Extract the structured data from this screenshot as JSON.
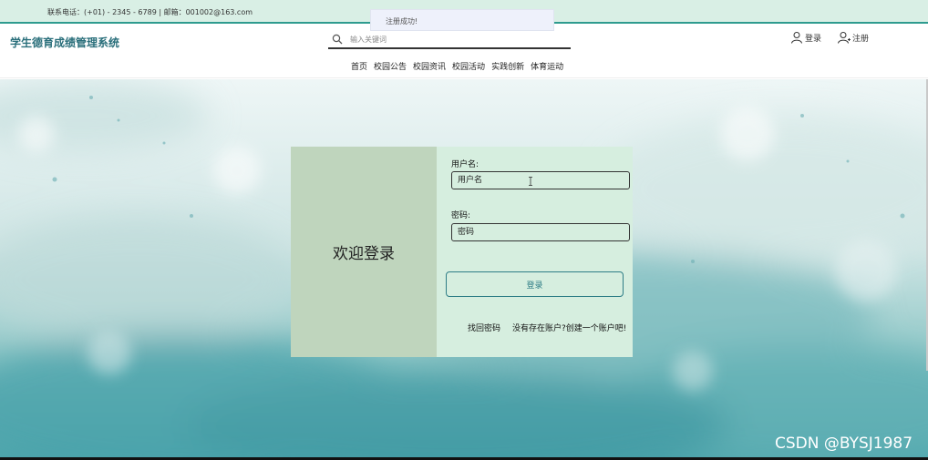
{
  "topbar": {
    "contact": "联系电话：(+01) - 2345 - 6789 | 邮箱：001002@163.com"
  },
  "toast": {
    "message": "注册成功!"
  },
  "header": {
    "site_title": "学生德育成绩管理系统",
    "search_placeholder": "输入关键词",
    "login_label": "登录",
    "register_label": "注册"
  },
  "nav": {
    "items": [
      "首页",
      "校园公告",
      "校园资讯",
      "校园活动",
      "实践创新",
      "体育运动"
    ]
  },
  "login_card": {
    "welcome": "欢迎登录",
    "username_label": "用户名:",
    "username_placeholder": "用户名",
    "password_label": "密码:",
    "password_placeholder": "密码",
    "submit_label": "登录",
    "forgot_link": "找回密码",
    "register_link": "没有存在账户?创建一个账户吧!"
  },
  "watermark": "CSDN @BYSJ1987",
  "colors": {
    "topbar_bg": "#d9efe5",
    "accent": "#2e9b8f",
    "title": "#2a6f7b",
    "card_left": "#bfd5bd",
    "card_right": "#d6eedf",
    "button_border": "#2e7d86"
  },
  "icons": {
    "search": "search-icon",
    "login": "user-icon",
    "register": "user-plus-icon"
  }
}
